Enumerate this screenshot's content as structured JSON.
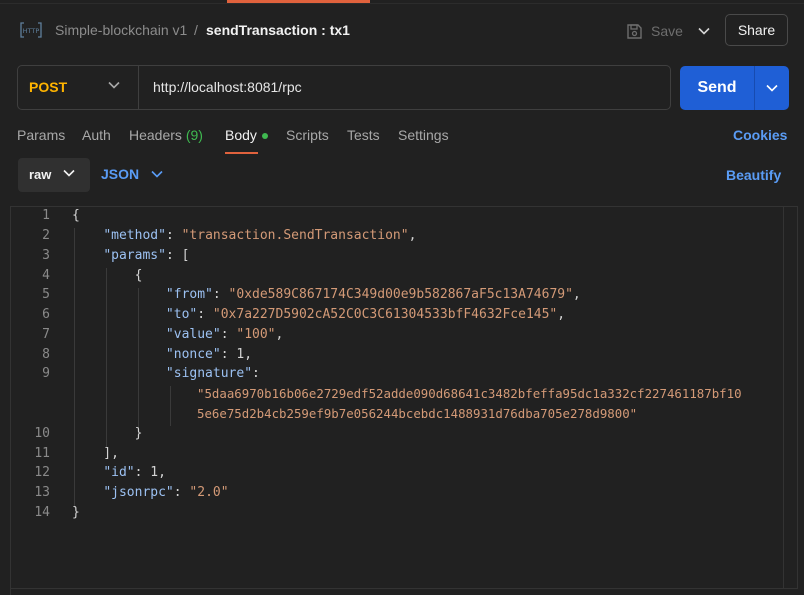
{
  "header": {
    "collection_name": "Simple-blockchain v1",
    "separator": "/",
    "request_name": "sendTransaction : tx1",
    "save_label": "Save",
    "share_label": "Share"
  },
  "request": {
    "method": "POST",
    "url": "http://localhost:8081/rpc",
    "send_label": "Send"
  },
  "tabs": {
    "params": "Params",
    "auth": "Auth",
    "headers": "Headers",
    "headers_count": "(9)",
    "body": "Body",
    "scripts": "Scripts",
    "tests": "Tests",
    "settings": "Settings",
    "active": "Body",
    "cookies": "Cookies"
  },
  "body_options": {
    "mode": "raw",
    "language": "JSON",
    "beautify": "Beautify"
  },
  "editor": {
    "line_numbers": [
      "1",
      "2",
      "3",
      "4",
      "5",
      "6",
      "7",
      "8",
      "9",
      "10",
      "11",
      "12",
      "13",
      "14"
    ],
    "method_key": "\"method\"",
    "method_value": "\"transaction.SendTransaction\"",
    "params_key": "\"params\"",
    "from_key": "\"from\"",
    "from_value": "\"0xde589C867174C349d00e9b582867aF5c13A74679\"",
    "to_key": "\"to\"",
    "to_value": "\"0x7a227D5902cA52C0C3C61304533bfF4632Fce145\"",
    "value_key": "\"value\"",
    "value_value": "\"100\"",
    "nonce_key": "\"nonce\"",
    "nonce_value": "1",
    "signature_key": "\"signature\"",
    "signature_line1": "\"5daa6970b16b06e2729edf52adde090d68641c3482bfeffa95dc1a332cf227461187bf10",
    "signature_line2": "5e6e75d2b4cb259ef9b7e056244bcebdc1488931d76dba705e278d9800\"",
    "id_key": "\"id\"",
    "id_value": "1",
    "jsonrpc_key": "\"jsonrpc\"",
    "jsonrpc_value": "\"2.0\""
  },
  "colors": {
    "accent": "#e0623d",
    "send_button": "#1f5fd6",
    "method": "#ffb400",
    "link": "#5a9cf5",
    "status_dot": "#3fb950",
    "json_key": "#9cc1f2",
    "json_string": "#d49a77"
  },
  "icons": [
    "http-icon",
    "save-icon",
    "chevron-down-icon"
  ]
}
